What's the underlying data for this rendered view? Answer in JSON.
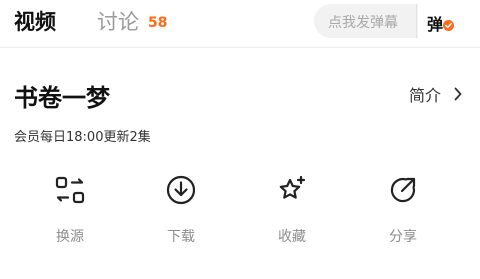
{
  "tabs": {
    "video_label": "视频",
    "discuss_label": "讨论",
    "discuss_count": "58"
  },
  "danmu": {
    "placeholder": "点我发弹幕",
    "toggle_label": "弹",
    "accent_color": "#ff6a1a"
  },
  "show": {
    "title": "书卷一梦",
    "intro_label": "简介",
    "update_info": "会员每日18:00更新2集"
  },
  "actions": [
    {
      "label": "换源",
      "icon": "switch-source-icon"
    },
    {
      "label": "下载",
      "icon": "download-icon"
    },
    {
      "label": "收藏",
      "icon": "star-sparkle-icon"
    },
    {
      "label": "分享",
      "icon": "share-icon"
    }
  ]
}
